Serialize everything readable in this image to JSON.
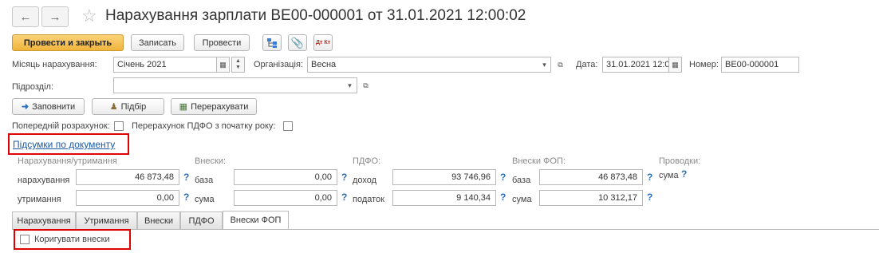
{
  "window": {
    "title": "Нарахування зарплати ВЕ00-000001 от 31.01.2021 12:00:02"
  },
  "toolbar": {
    "post_close": "Провести и закрыть",
    "save": "Записать",
    "post": "Провести",
    "dtkt_icon": "Дт Кт"
  },
  "header": {
    "month_label": "Місяць нарахування:",
    "month_value": "Січень 2021",
    "org_label": "Організація:",
    "org_value": "Весна",
    "date_label": "Дата:",
    "date_value": "31.01.2021 12:0",
    "number_label": "Номер:",
    "number_value": "ВЕ00-000001",
    "dept_label": "Підрозділ:",
    "dept_value": ""
  },
  "actions": {
    "fill": "Заповнити",
    "select": "Підбір",
    "recalc": "Перерахувати"
  },
  "options": {
    "preliminary_label": "Попередній розрахунок:",
    "pdfo_recalc_label": "Перерахунок ПДФО з початку року:"
  },
  "totals": {
    "link": "Підсумки по документу",
    "accrual_header": "Нарахування/утримання",
    "accrual_label": "нарахування",
    "accrual_value": "46 873,48",
    "deduction_label": "утримання",
    "deduction_value": "0,00",
    "contrib_header": "Внески:",
    "contrib_base_label": "база",
    "contrib_base_value": "0,00",
    "contrib_sum_label": "сума",
    "contrib_sum_value": "0,00",
    "pdfo_header": "ПДФО:",
    "pdfo_income_label": "доход",
    "pdfo_income_value": "93 746,96",
    "pdfo_tax_label": "податок",
    "pdfo_tax_value": "9 140,34",
    "fop_header": "Внески ФОП:",
    "fop_base_label": "база",
    "fop_base_value": "46 873,48",
    "fop_sum_label": "сума",
    "fop_sum_value": "10 312,17",
    "entries_header": "Проводки:",
    "entries_sum_label": "сума",
    "help": "?"
  },
  "tabs": [
    {
      "label": "Нарахування"
    },
    {
      "label": "Утримання"
    },
    {
      "label": "Внески"
    },
    {
      "label": "ПДФО"
    },
    {
      "label": "Внески ФОП"
    }
  ],
  "tab_content": {
    "adjust_label": "Коригувати внески"
  },
  "colors": {
    "primary_button": "#f0b43c",
    "highlight_box": "#e00000",
    "link": "#1a5aa8",
    "help": "#2a6fb8"
  }
}
